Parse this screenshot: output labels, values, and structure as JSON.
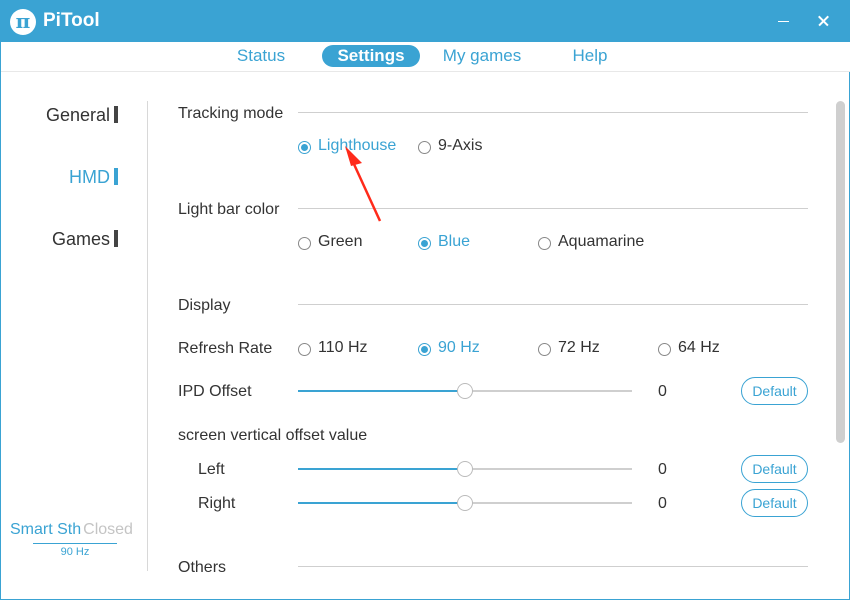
{
  "app": {
    "logo_glyph": "π",
    "title": "PiTool",
    "accent_color": "#3aa3d3"
  },
  "tabs": [
    {
      "label": "Status",
      "active": false
    },
    {
      "label": "Settings",
      "active": true
    },
    {
      "label": "My games",
      "active": false
    },
    {
      "label": "Help",
      "active": false
    }
  ],
  "sidebar": {
    "items": [
      {
        "label": "General",
        "active": false
      },
      {
        "label": "HMD",
        "active": true
      },
      {
        "label": "Games",
        "active": false
      }
    ],
    "smart": {
      "label": "Smart Sth",
      "state": "Closed",
      "rate": "90 Hz"
    }
  },
  "tracking": {
    "label": "Tracking mode",
    "options": [
      "Lighthouse",
      "9-Axis"
    ],
    "selected": "Lighthouse"
  },
  "light_bar": {
    "label": "Light bar color",
    "options": [
      "Green",
      "Blue",
      "Aquamarine"
    ],
    "selected": "Blue"
  },
  "display": {
    "label": "Display",
    "refresh_label": "Refresh Rate",
    "refresh_options": [
      "110 Hz",
      "90 Hz",
      "72 Hz",
      "64 Hz"
    ],
    "refresh_selected": "90 Hz",
    "ipd": {
      "label": "IPD Offset",
      "value": "0",
      "level": 0.5,
      "button": "Default"
    }
  },
  "vertical_offset": {
    "label": "screen vertical offset value",
    "left": {
      "label": "Left",
      "value": "0",
      "level": 0.5,
      "button": "Default"
    },
    "right": {
      "label": "Right",
      "value": "0",
      "level": 0.5,
      "button": "Default"
    }
  },
  "others": {
    "label": "Others"
  },
  "annotation": {
    "arrow_color": "#ff2a1a"
  }
}
